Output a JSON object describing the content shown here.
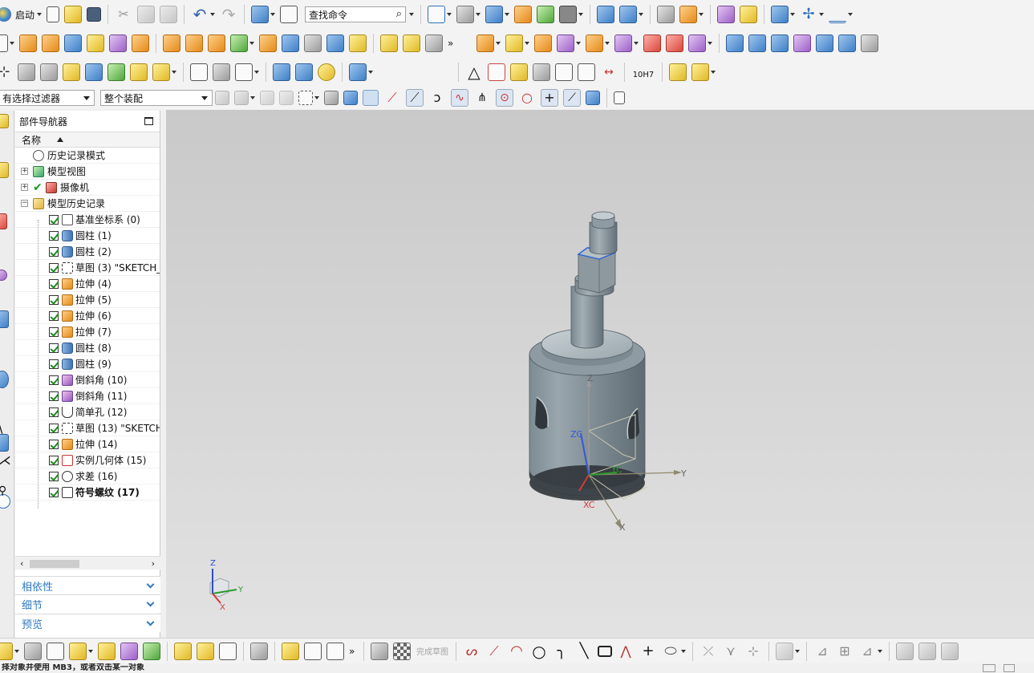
{
  "toolbar1": {
    "start_label": "启动",
    "search_placeholder": "查找命令"
  },
  "selection_bar": {
    "filter_value": "有选择过滤器",
    "scope_value": "整个装配"
  },
  "part_navigator": {
    "title": "部件导航器",
    "column_name": "名称",
    "top_nodes": [
      {
        "label": "历史记录模式"
      },
      {
        "label": "模型视图"
      },
      {
        "label": "摄像机"
      },
      {
        "label": "模型历史记录"
      }
    ],
    "features": [
      {
        "label": "基准坐标系 (0)",
        "icon": "datum-csys-icon"
      },
      {
        "label": "圆柱 (1)",
        "icon": "cylinder-icon"
      },
      {
        "label": "圆柱 (2)",
        "icon": "cylinder-icon"
      },
      {
        "label": "草图 (3) \"SKETCH_",
        "icon": "sketch-icon"
      },
      {
        "label": "拉伸 (4)",
        "icon": "extrude-icon"
      },
      {
        "label": "拉伸 (5)",
        "icon": "extrude-icon"
      },
      {
        "label": "拉伸 (6)",
        "icon": "extrude-icon"
      },
      {
        "label": "拉伸 (7)",
        "icon": "extrude-icon"
      },
      {
        "label": "圆柱 (8)",
        "icon": "cylinder-icon"
      },
      {
        "label": "圆柱 (9)",
        "icon": "cylinder-icon"
      },
      {
        "label": "倒斜角 (10)",
        "icon": "chamfer-icon"
      },
      {
        "label": "倒斜角 (11)",
        "icon": "chamfer-icon"
      },
      {
        "label": "简单孔 (12)",
        "icon": "hole-icon"
      },
      {
        "label": "草图 (13) \"SKETCH",
        "icon": "sketch-icon"
      },
      {
        "label": "拉伸 (14)",
        "icon": "extrude-icon"
      },
      {
        "label": "实例几何体 (15)",
        "icon": "instance-geometry-icon"
      },
      {
        "label": "求差 (16)",
        "icon": "subtract-icon"
      },
      {
        "label": "符号螺纹 (17)",
        "icon": "thread-icon"
      }
    ]
  },
  "panels": {
    "dependencies": "相依性",
    "details": "细节",
    "preview": "预览"
  },
  "viewport": {
    "axis_z": "Z",
    "axis_zc": "ZC",
    "axis_yc": "YC",
    "axis_xc": "XC",
    "axis_y": "Y",
    "axis_x": "X",
    "triad_z": "Z",
    "triad_y": "Y",
    "triad_x": "X"
  },
  "bottom_toolbar": {
    "finish_sketch": "完成草图"
  },
  "status": {
    "message": "择对象并使用 MB3，或者双击某一对象"
  },
  "tolerance_label": "10H7"
}
